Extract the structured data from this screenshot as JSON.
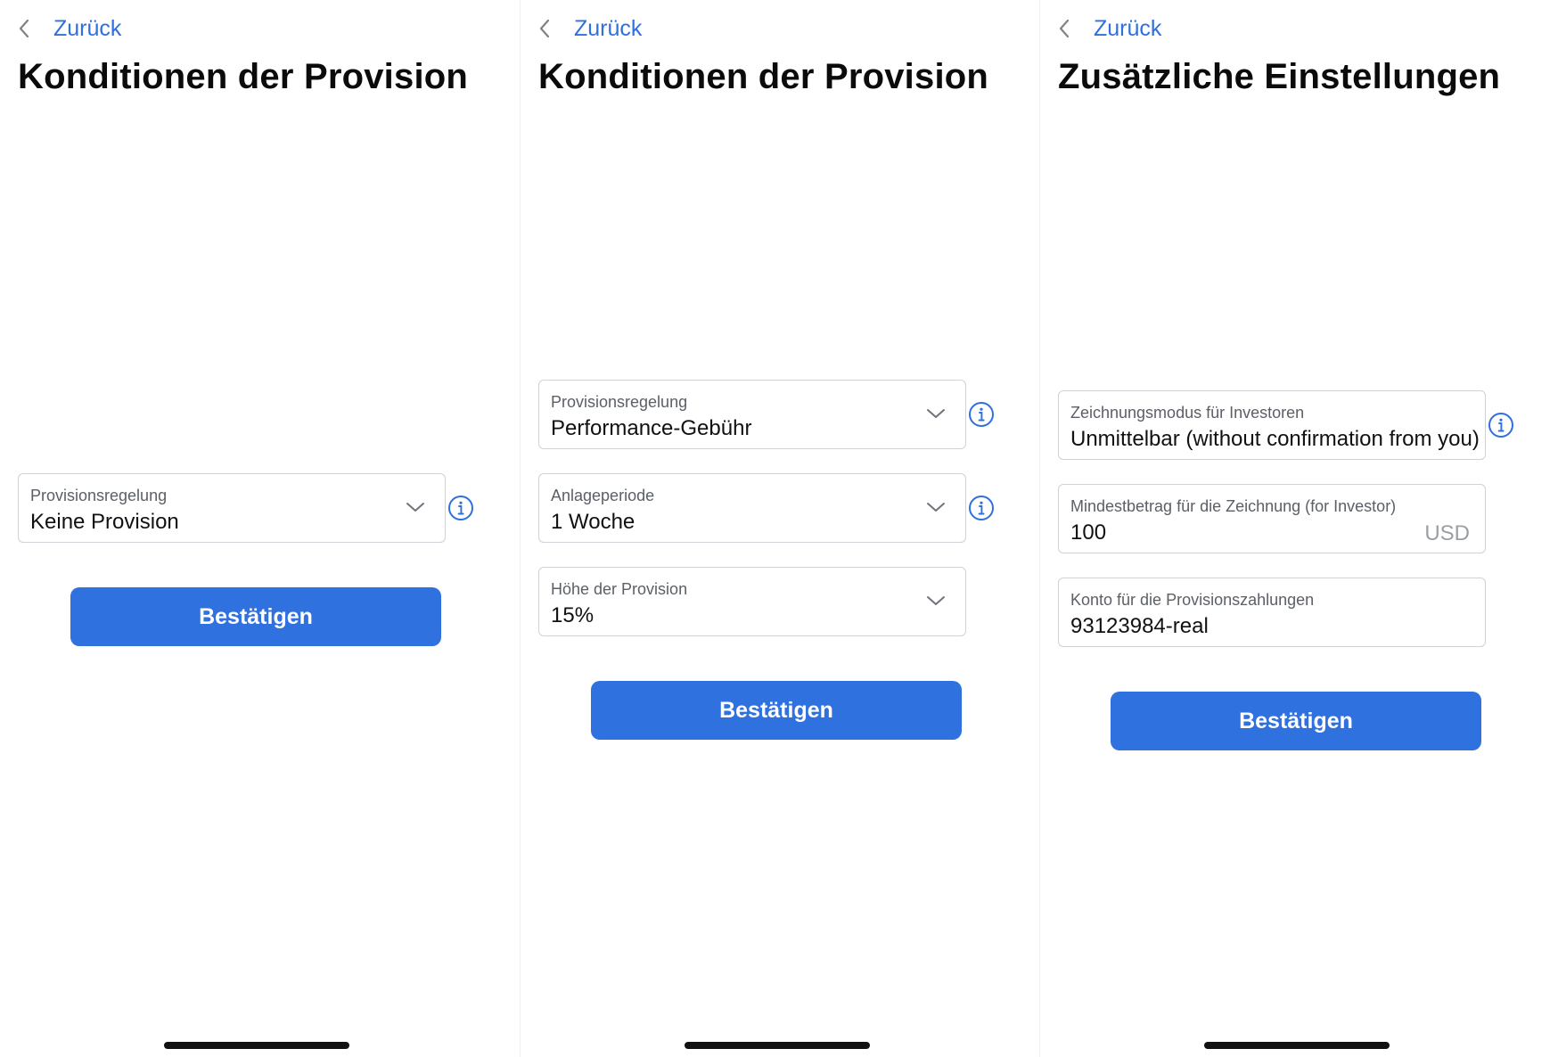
{
  "screens": [
    {
      "back_label": "Zurück",
      "title": "Konditionen der Provision",
      "fields": [
        {
          "label": "Provisionsregelung",
          "value": "Keine Provision"
        }
      ],
      "confirm_label": "Bestätigen"
    },
    {
      "back_label": "Zurück",
      "title": "Konditionen der Provision",
      "fields": [
        {
          "label": "Provisionsregelung",
          "value": "Performance-Gebühr"
        },
        {
          "label": "Anlageperiode",
          "value": "1 Woche"
        },
        {
          "label": "Höhe der Provision",
          "value": "15%"
        }
      ],
      "confirm_label": "Bestätigen"
    },
    {
      "back_label": "Zurück",
      "title": "Zusätzliche Einstellungen",
      "fields": [
        {
          "label": "Zeichnungsmodus für Investoren",
          "value": "Unmittelbar (without confirmation from you)"
        },
        {
          "label": "Mindestbetrag für die Zeichnung (for Investor)",
          "value": "100",
          "unit": "USD"
        },
        {
          "label": "Konto für die Provisionszahlungen",
          "value": "93123984-real"
        }
      ],
      "confirm_label": "Bestätigen"
    }
  ],
  "colors": {
    "accent": "#2f71df",
    "link": "#2f6fde",
    "border": "#cfd2d6",
    "label_text": "#5b5f66"
  },
  "icons": {
    "back": "chevron-left-icon",
    "dropdown": "chevron-down-icon",
    "info": "info-icon"
  }
}
